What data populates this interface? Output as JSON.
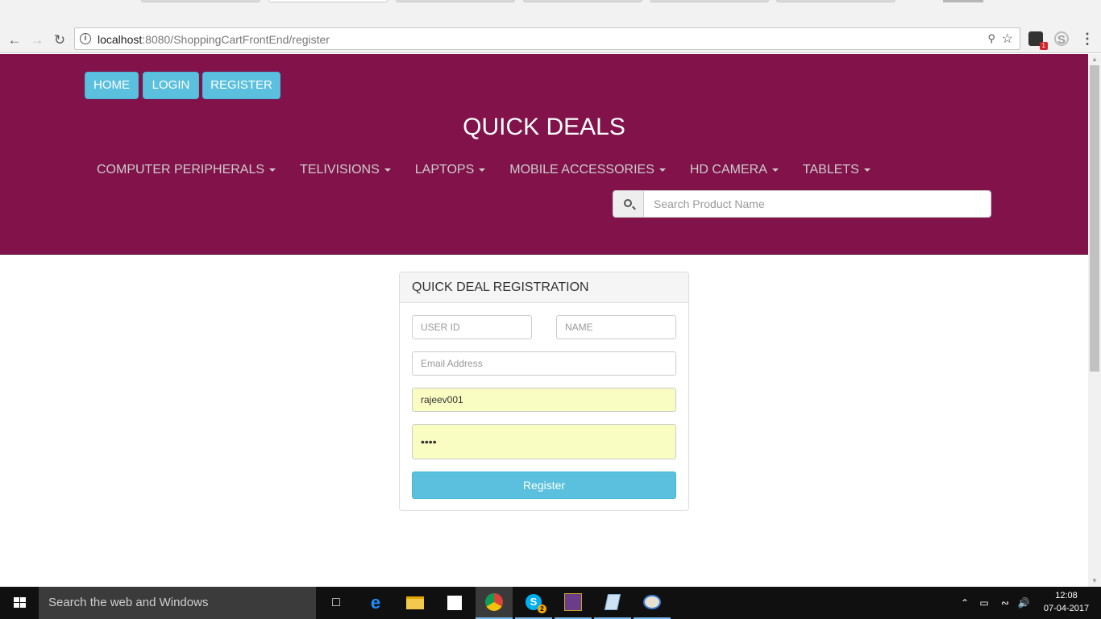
{
  "browser": {
    "url_host": "localhost",
    "url_path": ":8080/ShoppingCartFrontEnd/register",
    "extension_badge": "1"
  },
  "site": {
    "top_buttons": {
      "home": "HOME",
      "login": "LOGIN",
      "register": "REGISTER"
    },
    "brand": "QUICK DEALS",
    "categories": [
      {
        "label": "COMPUTER PERIPHERALS"
      },
      {
        "label": "TELIVISIONS"
      },
      {
        "label": "LAPTOPS"
      },
      {
        "label": "MOBILE ACCESSORIES"
      },
      {
        "label": "HD CAMERA"
      },
      {
        "label": "TABLETS"
      }
    ],
    "search": {
      "placeholder": "Search Product Name"
    }
  },
  "registration": {
    "title": "QUICK DEAL REGISTRATION",
    "user_id_placeholder": "USER ID",
    "name_placeholder": "NAME",
    "email_placeholder": "Email Address",
    "username_value": "rajeev001",
    "password_value": "••••",
    "submit_label": "Register"
  },
  "taskbar": {
    "search_text": "Search the web and Windows",
    "skype_badge": "2",
    "time": "12:08",
    "date": "07-04-2017"
  },
  "colors": {
    "banner": "#81124a",
    "button": "#5bc0de",
    "autofill": "#fafdc2"
  }
}
